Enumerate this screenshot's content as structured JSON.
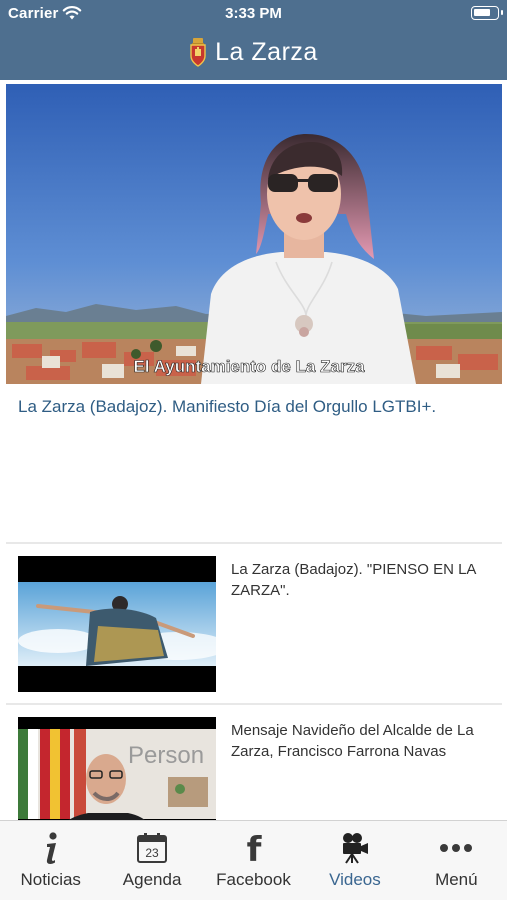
{
  "status_bar": {
    "carrier": "Carrier",
    "time": "3:33 PM",
    "battery_level": 0.75
  },
  "header": {
    "title": "La Zarza",
    "crest_icon": "coat-of-arms-icon"
  },
  "featured": {
    "overlay_caption": "El Ayuntamiento de La Zarza",
    "title": "La Zarza (Badajoz). Manifiesto Día del Orgullo LGTBI+."
  },
  "videos": [
    {
      "title": "La Zarza (Badajoz). \"PIENSO EN LA ZARZA\"."
    },
    {
      "title": "Mensaje Navideño del Alcalde de La Zarza, Francisco Farrona Navas",
      "thumb_text": "Person"
    }
  ],
  "tabs": [
    {
      "label": "Noticias",
      "icon": "info-icon"
    },
    {
      "label": "Agenda",
      "icon": "calendar-icon",
      "icon_text": "23"
    },
    {
      "label": "Facebook",
      "icon": "facebook-icon",
      "icon_text": "f"
    },
    {
      "label": "Videos",
      "icon": "video-camera-icon",
      "active": true
    },
    {
      "label": "Menú",
      "icon": "more-icon"
    }
  ],
  "colors": {
    "header_bg": "#4e6f8f",
    "accent": "#3a6690",
    "link": "#2f5d84"
  }
}
